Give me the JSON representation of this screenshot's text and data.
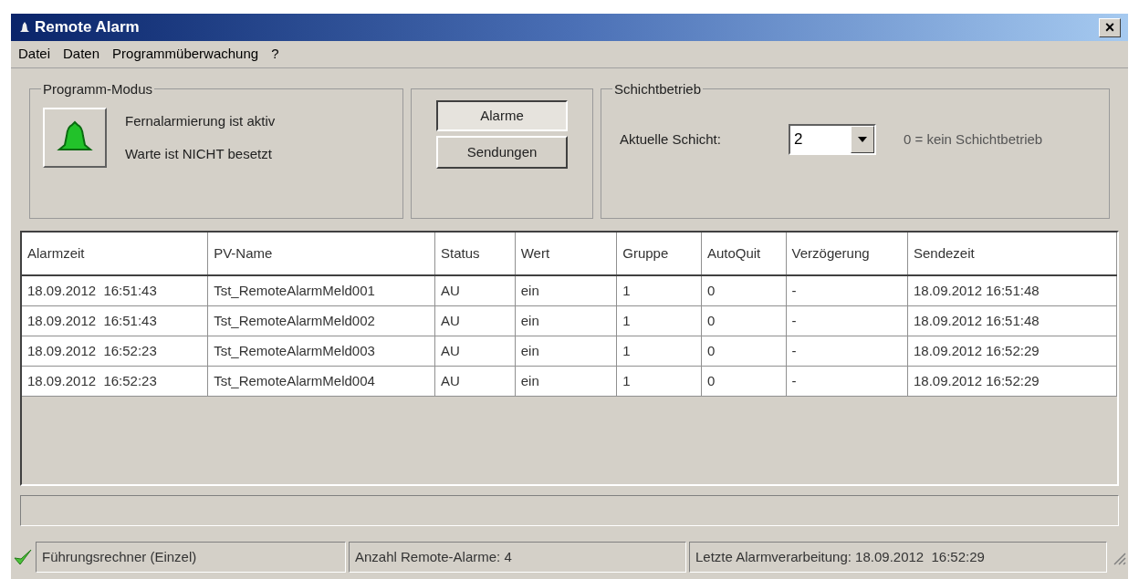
{
  "window": {
    "title": "Remote Alarm",
    "close": "×"
  },
  "menu": [
    "Datei",
    "Daten",
    "Programmüberwachung",
    "?"
  ],
  "program_mode": {
    "title": "Programm-Modus",
    "lines": [
      "Fernalarmierung ist aktiv",
      "Warte ist NICHT besetzt"
    ]
  },
  "view_buttons": [
    {
      "label": "Alarme",
      "selected": true
    },
    {
      "label": "Sendungen",
      "selected": false
    }
  ],
  "shift": {
    "title": "Schichtbetrieb",
    "label": "Aktuelle Schicht:",
    "value": "2",
    "hint": "0 = kein Schichtbetrieb"
  },
  "table": {
    "columns": [
      "Alarmzeit",
      "PV-Name",
      "Status",
      "Wert",
      "Gruppe",
      "AutoQuit",
      "Verzögerung",
      "Sendezeit"
    ],
    "rows": [
      [
        "18.09.2012  16:51:43",
        "Tst_RemoteAlarmMeld001",
        "AU",
        "ein",
        "1",
        "0",
        "-",
        "18.09.2012 16:51:48"
      ],
      [
        "18.09.2012  16:51:43",
        "Tst_RemoteAlarmMeld002",
        "AU",
        "ein",
        "1",
        "0",
        "-",
        "18.09.2012 16:51:48"
      ],
      [
        "18.09.2012  16:52:23",
        "Tst_RemoteAlarmMeld003",
        "AU",
        "ein",
        "1",
        "0",
        "-",
        "18.09.2012 16:52:29"
      ],
      [
        "18.09.2012  16:52:23",
        "Tst_RemoteAlarmMeld004",
        "AU",
        "ein",
        "1",
        "0",
        "-",
        "18.09.2012 16:52:29"
      ]
    ]
  },
  "status_bar": [
    "Führungsrechner (Einzel)",
    "Anzahl Remote-Alarme: 4",
    "Letzte Alarmverarbeitung: 18.09.2012  16:52:29"
  ]
}
